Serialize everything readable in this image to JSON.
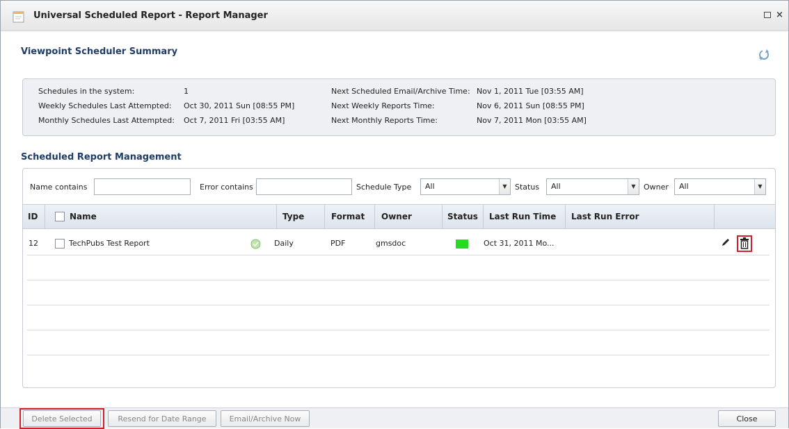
{
  "window": {
    "title": "Universal Scheduled Report - Report Manager",
    "close_glyph": "×"
  },
  "summary": {
    "title": "Viewpoint Scheduler Summary",
    "rows": [
      {
        "label": "Schedules in the system:",
        "value": "1"
      },
      {
        "label": "Weekly Schedules Last Attempted:",
        "value": "Oct 30, 2011 Sun [08:55 PM]"
      },
      {
        "label": "Monthly Schedules Last Attempted:",
        "value": "Oct 7, 2011 Fri [03:55 AM]"
      }
    ],
    "next": [
      {
        "label": "Next Scheduled Email/Archive Time:",
        "value": "Nov 1, 2011 Tue [03:55 AM]"
      },
      {
        "label": "Next Weekly Reports Time:",
        "value": "Nov 6, 2011 Sun [08:55 PM]"
      },
      {
        "label": "Next Monthly Reports Time:",
        "value": "Nov 7, 2011 Mon [03:55 AM]"
      }
    ]
  },
  "management": {
    "title": "Scheduled Report Management",
    "filters": {
      "name_label": "Name contains",
      "name_value": "",
      "error_label": "Error contains",
      "error_value": "",
      "schedule_type_label": "Schedule Type",
      "schedule_type_value": "All",
      "status_label": "Status",
      "status_value": "All",
      "owner_label": "Owner",
      "owner_value": "All"
    },
    "columns": {
      "id": "ID",
      "name": "Name",
      "type": "Type",
      "format": "Format",
      "owner": "Owner",
      "status": "Status",
      "last_run_time": "Last Run Time",
      "last_run_error": "Last Run Error"
    },
    "rows": [
      {
        "id": "12",
        "name": "TechPubs Test Report",
        "type": "Daily",
        "format": "PDF",
        "owner": "gmsdoc",
        "status_color": "#22dd22",
        "last_run_time": "Oct 31, 2011 Mo...",
        "last_run_error": ""
      }
    ]
  },
  "footer": {
    "delete_selected": "Delete Selected",
    "resend": "Resend for Date Range",
    "email_archive": "Email/Archive Now",
    "close": "Close"
  },
  "colors": {
    "highlight": "#d0202a",
    "section_title": "#1f3d66"
  }
}
